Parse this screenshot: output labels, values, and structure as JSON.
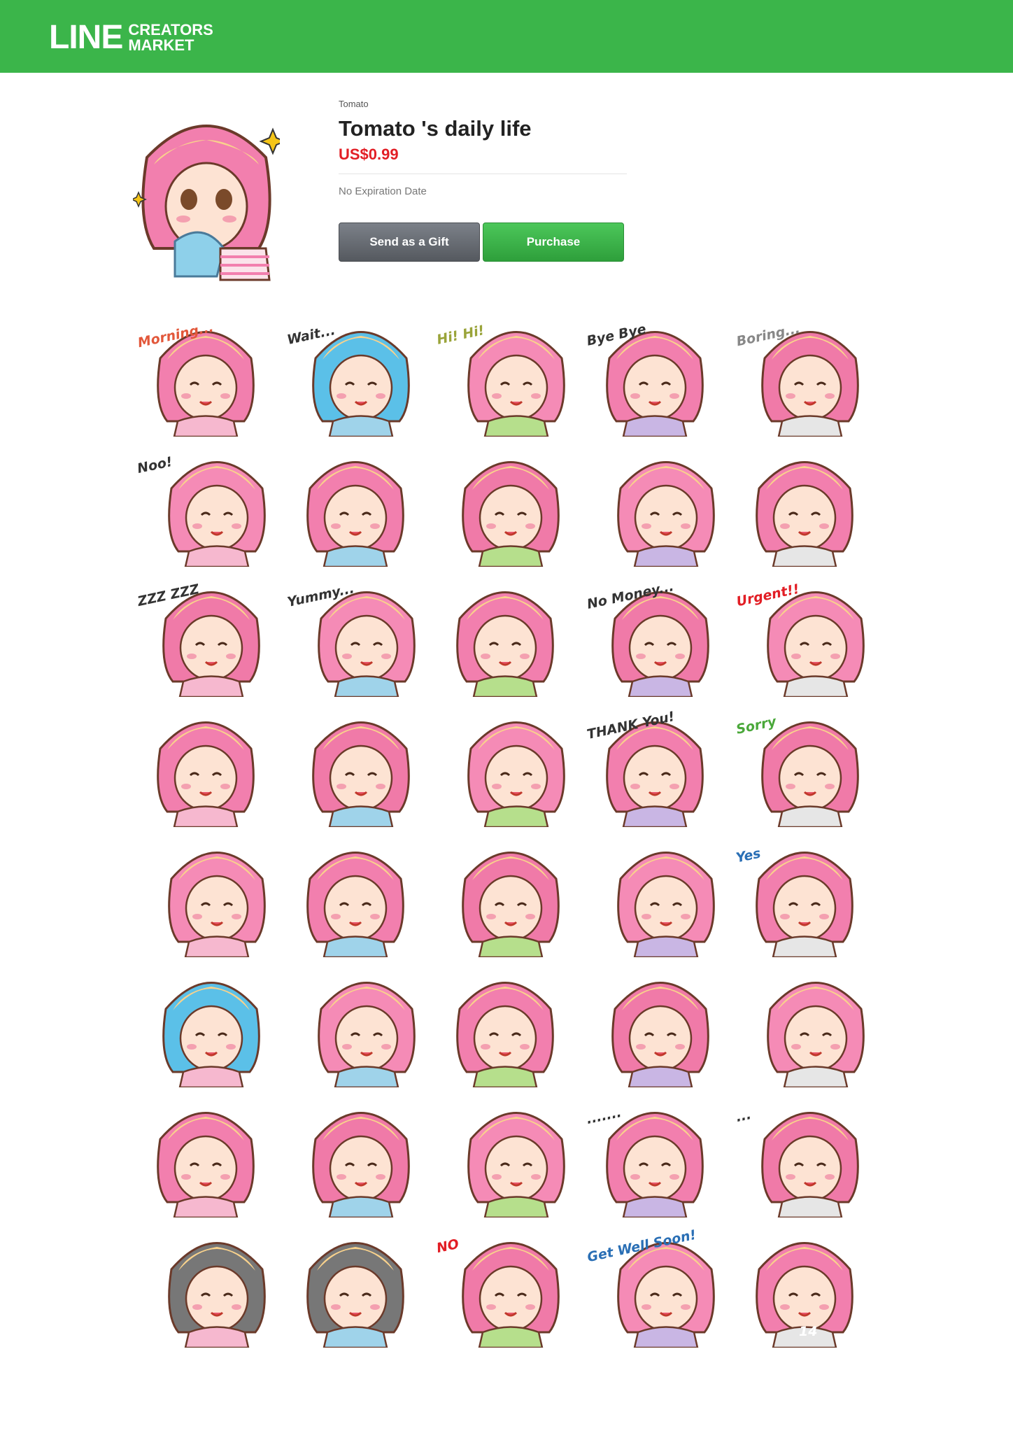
{
  "header": {
    "logo_line": "LINE",
    "logo_sub_1": "CREATORS",
    "logo_sub_2": "MARKET",
    "brand_color": "#3bb54a"
  },
  "product": {
    "creator": "Tomato",
    "title": "Tomato 's daily life",
    "price": "US$0.99",
    "expiry": "No Expiration Date",
    "price_color": "#e21e25"
  },
  "buttons": {
    "gift": "Send as a Gift",
    "purchase": "Purchase"
  },
  "stickers": [
    {
      "caption": "Morning...",
      "caption_color": "#e2573a"
    },
    {
      "caption": "Wait...",
      "caption_color": "#333333"
    },
    {
      "caption": "Hi! Hi!",
      "caption_color": "#9aa43a"
    },
    {
      "caption": "Bye Bye",
      "caption_color": "#333333"
    },
    {
      "caption": "Boring...",
      "caption_color": "#888888"
    },
    {
      "caption": "Noo!",
      "caption_color": "#333333"
    },
    {
      "caption": "",
      "caption_color": ""
    },
    {
      "caption": "",
      "caption_color": ""
    },
    {
      "caption": "",
      "caption_color": ""
    },
    {
      "caption": "",
      "caption_color": ""
    },
    {
      "caption": "ZZZ ZZZ",
      "caption_color": "#333333"
    },
    {
      "caption": "Yummy...",
      "caption_color": "#333333"
    },
    {
      "caption": "",
      "caption_color": ""
    },
    {
      "caption": "No Money...",
      "caption_color": "#333333"
    },
    {
      "caption": "Urgent!!",
      "caption_color": "#e21e25"
    },
    {
      "caption": "",
      "caption_color": ""
    },
    {
      "caption": "",
      "caption_color": ""
    },
    {
      "caption": "",
      "caption_color": ""
    },
    {
      "caption": "THANK You!",
      "caption_color": "#333333"
    },
    {
      "caption": "Sorry",
      "caption_color": "#4aa83a"
    },
    {
      "caption": "",
      "caption_color": ""
    },
    {
      "caption": "",
      "caption_color": ""
    },
    {
      "caption": "",
      "caption_color": ""
    },
    {
      "caption": "",
      "caption_color": ""
    },
    {
      "caption": "Yes",
      "caption_color": "#2a6fb5"
    },
    {
      "caption": "",
      "caption_color": ""
    },
    {
      "caption": "",
      "caption_color": ""
    },
    {
      "caption": "",
      "caption_color": ""
    },
    {
      "caption": "",
      "caption_color": ""
    },
    {
      "caption": "",
      "caption_color": ""
    },
    {
      "caption": "",
      "caption_color": ""
    },
    {
      "caption": "",
      "caption_color": ""
    },
    {
      "caption": "",
      "caption_color": ""
    },
    {
      "caption": ".......",
      "caption_color": "#333333"
    },
    {
      "caption": "...",
      "caption_color": "#333333"
    },
    {
      "caption": "",
      "caption_color": ""
    },
    {
      "caption": "",
      "caption_color": ""
    },
    {
      "caption": "NO",
      "caption_color": "#e21e25"
    },
    {
      "caption": "Get Well Soon!",
      "caption_color": "#2a6fb5"
    },
    {
      "caption": "14",
      "caption_color": "#ffffff"
    }
  ]
}
